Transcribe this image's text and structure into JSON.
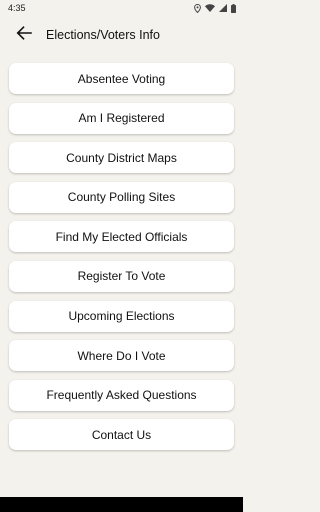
{
  "status_bar": {
    "time": "4:35",
    "icons": [
      "location-icon",
      "wifi-icon",
      "signal-icon",
      "battery-icon"
    ]
  },
  "app_bar": {
    "title": "Elections/Voters Info",
    "back_icon": "arrow-left-icon"
  },
  "menu": {
    "items": [
      {
        "label": "Absentee Voting"
      },
      {
        "label": "Am I Registered"
      },
      {
        "label": "County District Maps"
      },
      {
        "label": "County Polling Sites"
      },
      {
        "label": "Find My Elected Officials"
      },
      {
        "label": "Register To Vote"
      },
      {
        "label": "Upcoming Elections"
      },
      {
        "label": "Where Do I Vote"
      },
      {
        "label": "Frequently Asked Questions"
      },
      {
        "label": "Contact Us"
      }
    ]
  },
  "colors": {
    "background": "#f4f2ec",
    "card": "#ffffff",
    "text": "#111111",
    "nav_bar": "#000000"
  }
}
